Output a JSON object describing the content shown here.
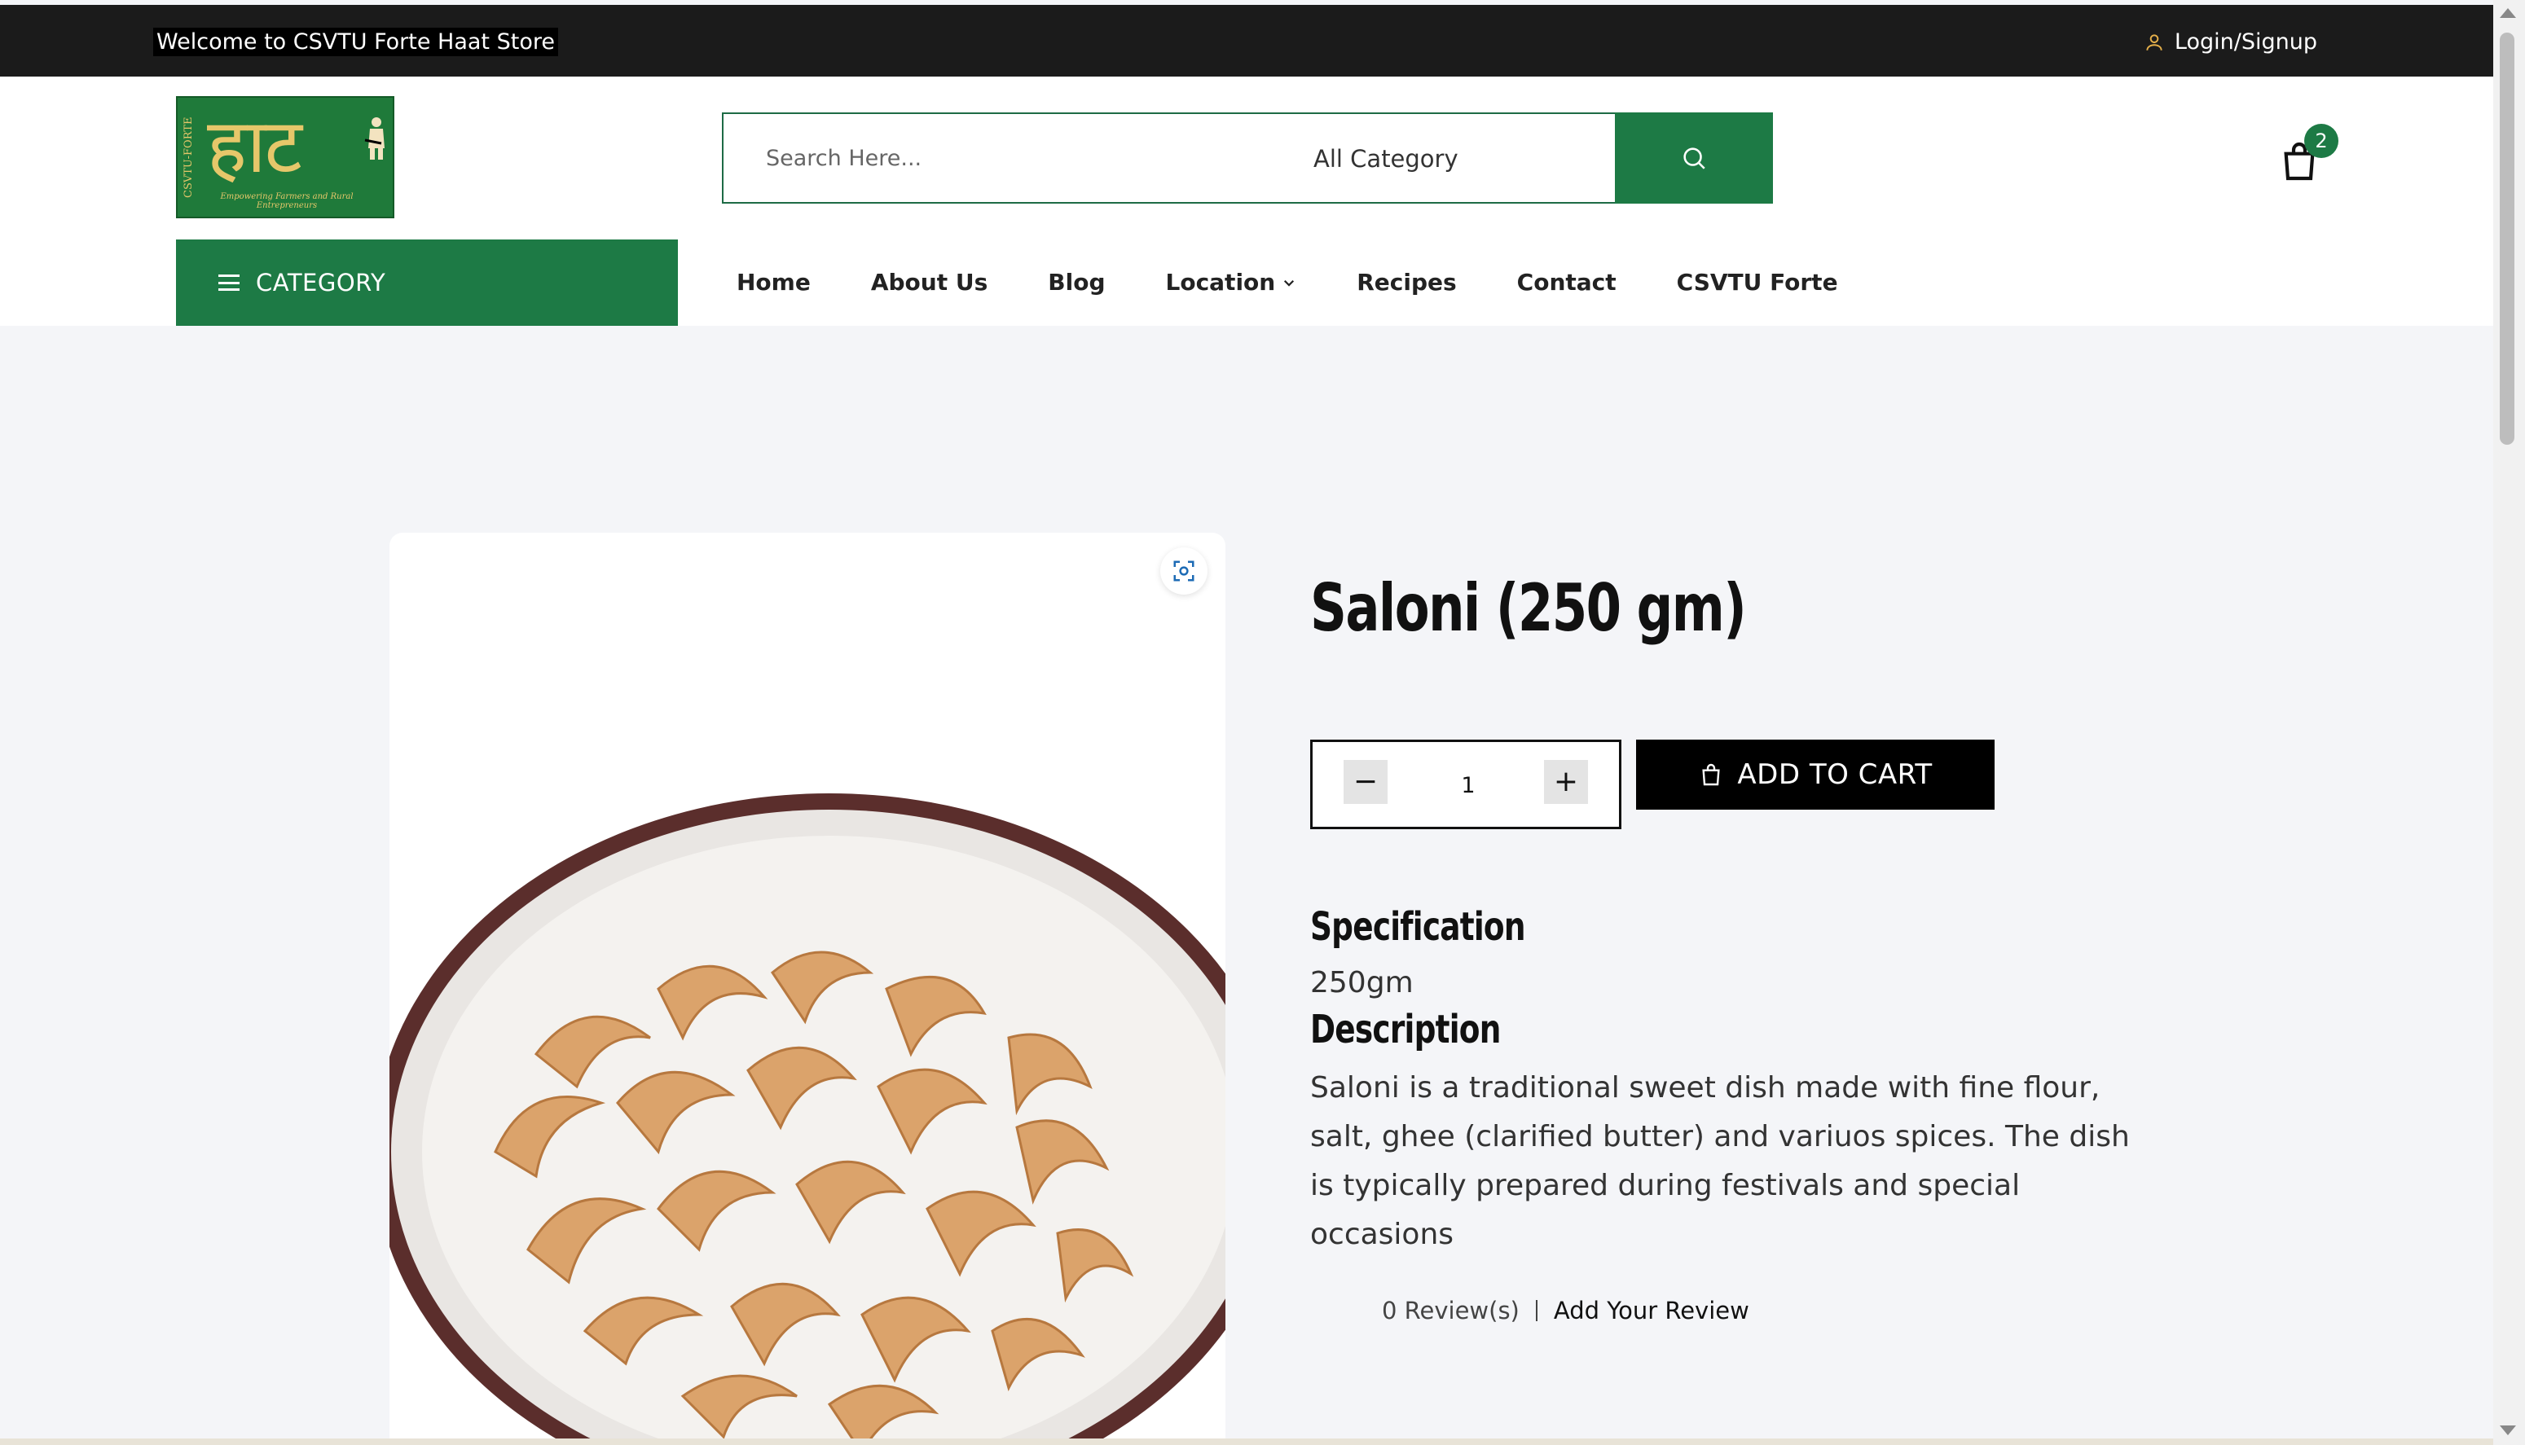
{
  "topbar": {
    "welcome": "Welcome to CSVTU Forte Haat Store",
    "login": "Login/Signup"
  },
  "logo": {
    "main_text": "हाट",
    "side_text": "CSVTU-FORTE",
    "tagline": "Empowering Farmers and Rural Entrepreneurs"
  },
  "search": {
    "placeholder": "Search Here...",
    "category": "All Category"
  },
  "cart": {
    "count": "2"
  },
  "category_button": "CATEGORY",
  "nav": {
    "home": "Home",
    "about": "About Us",
    "blog": "Blog",
    "location": "Location",
    "recipes": "Recipes",
    "contact": "Contact",
    "forte": "CSVTU Forte"
  },
  "product": {
    "title": "Saloni (250 gm)",
    "quantity": "1",
    "minus": "−",
    "plus": "+",
    "add_to_cart": "ADD TO CART",
    "spec_heading": "Specification",
    "spec_value": "250gm",
    "desc_heading": "Description",
    "description": "Saloni is a traditional sweet dish made with fine flour, salt, ghee (clarified butter) and variuos spices. The dish is typically prepared during festivals and special occasions",
    "reviews": "0 Review(s)",
    "add_review": "Add Your Review"
  },
  "colors": {
    "brand_green": "#1d7a45",
    "topbar": "#1b1b1b",
    "cta": "#000000"
  }
}
